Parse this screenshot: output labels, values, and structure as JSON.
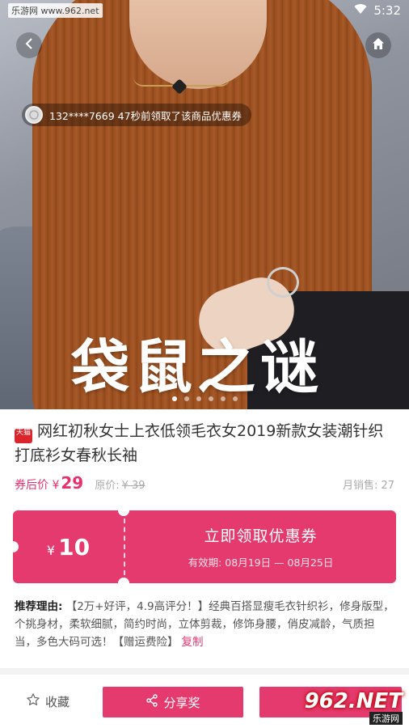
{
  "status_bar": {
    "watermark_site": "乐游网 www.962.net",
    "time": "5:32"
  },
  "hero": {
    "claim_toast": "132****7669 47秒前领取了该商品优惠券",
    "watermark_text": "袋鼠之谜",
    "carousel": {
      "total": 6,
      "active_index": 0
    }
  },
  "product": {
    "badge_text": "天猫",
    "title": "网红初秋女士上衣低领毛衣女2019新款女装潮针织打底衫女春秋长袖",
    "coupon_price_label": "券后价 ¥",
    "coupon_price": "29",
    "original_label": "原价:",
    "original_price": "¥ 39",
    "sales": "月销售: 27"
  },
  "coupon": {
    "currency": "¥",
    "amount": "10",
    "cta": "立即领取优惠券",
    "validity": "有效期: 08月19日 — 08月25日"
  },
  "reason": {
    "label": "推荐理由:",
    "text": "【2万+好评，4.9高评分！】经典百搭显瘦毛衣针织衫，修身版型，个挑身材，柔软细腻，简约时尚，立体剪裁，修饰身腰，俏皮减龄，气质担当，多色大码可选！【赠运费险】",
    "copy_label": "复制"
  },
  "bottom_bar": {
    "favorite_label": "收藏",
    "share_label": "分享奖",
    "corner_brand": "962.NET",
    "corner_sub": "乐游网"
  },
  "colors": {
    "accent": "#e43a6d"
  }
}
